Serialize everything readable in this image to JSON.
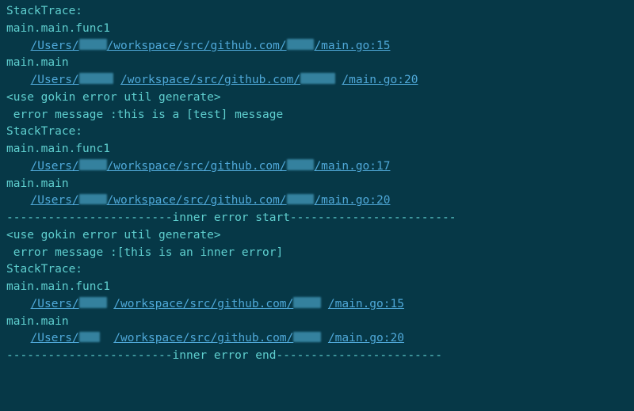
{
  "terminal": {
    "stacktrace_label": "StackTrace:",
    "func1_label": "main.main.func1",
    "main_label": "main.main",
    "path_prefix": "/Users/",
    "path_middle": "/workspace/src/github.com/",
    "path_file_15": "/main.go:15",
    "path_file_17": "/main.go:17",
    "path_file_20": "/main.go:20",
    "gokin_header": "<use gokin error util generate>",
    "error_msg_prefix": " error message :",
    "error_msg_test": "this is a [test] message",
    "error_msg_inner": "[this is an inner error]",
    "inner_start": "------------------------inner error start------------------------",
    "inner_end": "------------------------inner error end------------------------",
    "blank": ""
  }
}
